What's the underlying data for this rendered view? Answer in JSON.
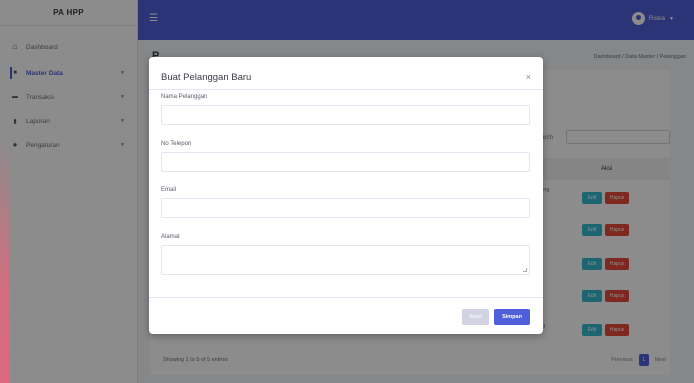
{
  "brand": "PA HPP",
  "sidebar": {
    "items": [
      {
        "label": "Dashboard",
        "icon": "home-icon"
      },
      {
        "label": "Master Data",
        "icon": "database-icon"
      },
      {
        "label": "Transaksi",
        "icon": "folder-icon"
      },
      {
        "label": "Laporan",
        "icon": "file-icon"
      },
      {
        "label": "Pengaturan",
        "icon": "cogs-icon"
      }
    ]
  },
  "topbar": {
    "user": "Riska"
  },
  "page": {
    "title": "P",
    "breadcrumb": "Dashboard / Data Master / Pelanggan",
    "search_label": "earch",
    "table_header": "Aksi",
    "row_texts": [
      "bing",
      "ng"
    ],
    "edit_label": "Edit",
    "hapus_label": "Hapus",
    "showing": "Showing 1 to 5 of 5 entries",
    "pager": {
      "prev": "Previous",
      "page": "1",
      "next": "Next"
    }
  },
  "modal": {
    "title": "Buat Pelanggan Baru",
    "close": "×",
    "fields": [
      {
        "label": "Nama Pelanggan",
        "value": ""
      },
      {
        "label": "No Telepon",
        "value": ""
      },
      {
        "label": "Email",
        "value": ""
      },
      {
        "label": "Alamat",
        "value": ""
      }
    ],
    "batal": "Batal",
    "simpan": "Simpan"
  },
  "colors": {
    "primary": "#4e5fd9",
    "info": "#36b9cc",
    "danger": "#e74a3b"
  }
}
